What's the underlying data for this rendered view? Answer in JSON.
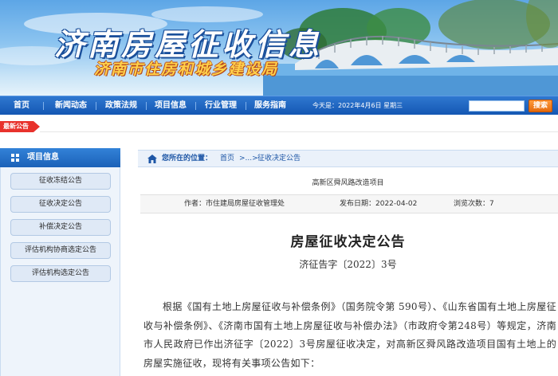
{
  "header": {
    "site_title": "济南房屋征收信息",
    "site_subtitle": "济南市住房和城乡建设局"
  },
  "nav": {
    "items": [
      "首页",
      "新闻动态",
      "政策法规",
      "项目信息",
      "行业管理",
      "服务指南"
    ],
    "date_text": "今天是：2022年4月6日 星期三",
    "search_placeholder": "",
    "search_button": "搜索"
  },
  "news_tag": "最新公告",
  "sidebar": {
    "title": "项目信息",
    "items": [
      "征收冻结公告",
      "征收决定公告",
      "补偿决定公告",
      "评估机构协商选定公告",
      "评估机构选定公告"
    ]
  },
  "breadcrumb": {
    "label": "您所在的位置：",
    "home": "首页",
    "mid": ">...>",
    "current": "征收决定公告"
  },
  "article": {
    "project_name": "高新区舜风路改造项目",
    "author": "作者：市住建局房屋征收管理处",
    "publish_date": "发布日期：2022-04-02",
    "views": "浏览次数：7",
    "title": "房屋征收决定公告",
    "doc_number": "济征告字〔2022〕3号",
    "body": "根据《国有土地上房屋征收与补偿条例》（国务院令第 590号）、《山东省国有土地上房屋征收与补偿条例》、《济南市国有土地上房屋征收与补偿办法》（市政府令第248号）等规定，济南市人民政府已作出济征字〔2022〕3号房屋征收决定，对高新区舜风路改造项目国有土地上的房屋实施征收，现将有关事项公告如下："
  },
  "colors": {
    "nav_blue": "#1457b3",
    "accent_red": "#e8322c",
    "search_orange": "#e46a0c",
    "link_blue": "#1d56a6"
  }
}
